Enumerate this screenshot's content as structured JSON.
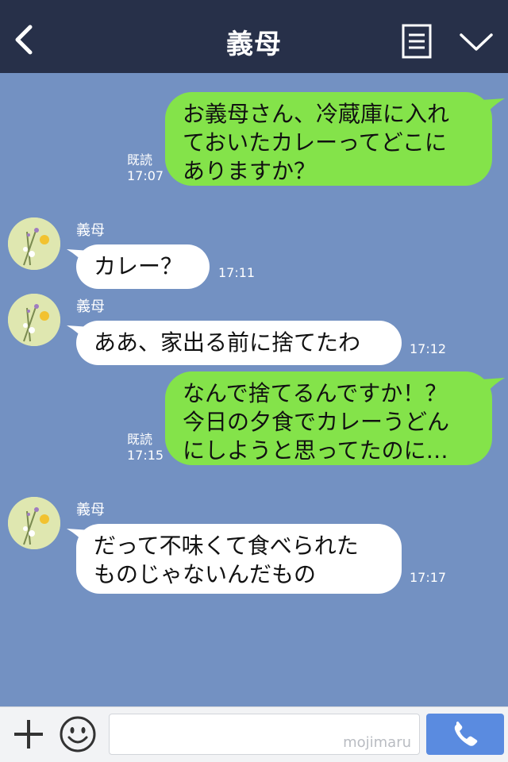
{
  "header": {
    "title": "義母"
  },
  "messages": [
    {
      "side": "me",
      "lines": [
        "お義母さん、冷蔵庫に入れ",
        "ておいたカレーってどこに",
        "ありますか？"
      ],
      "read": "既読",
      "time": "17:07"
    },
    {
      "side": "them",
      "name": "義母",
      "lines": [
        "カレー？"
      ],
      "time": "17:11"
    },
    {
      "side": "them",
      "name": "義母",
      "lines": [
        "ああ、家出る前に捨てたわ"
      ],
      "time": "17:12"
    },
    {
      "side": "me",
      "lines": [
        "なんで捨てるんですか！？",
        "今日の夕食でカレーうどん",
        "にしようと思ってたのに…"
      ],
      "read": "既読",
      "time": "17:15"
    },
    {
      "side": "them",
      "name": "義母",
      "lines": [
        "だって不味くて食べられた",
        "ものじゃないんだもの"
      ],
      "time": "17:17"
    }
  ],
  "input": {
    "watermark": "mojimaru"
  },
  "colors": {
    "header_bg": "#273049",
    "chat_bg": "#7391c2",
    "my_bubble": "#84e34a",
    "their_bubble": "#ffffff",
    "call_button": "#5a8be0"
  },
  "icons": {
    "back": "chevron-left-icon",
    "menu": "document-icon",
    "collapse": "chevron-down-icon",
    "plus": "plus-icon",
    "emoji": "smiley-icon",
    "call": "phone-icon"
  }
}
